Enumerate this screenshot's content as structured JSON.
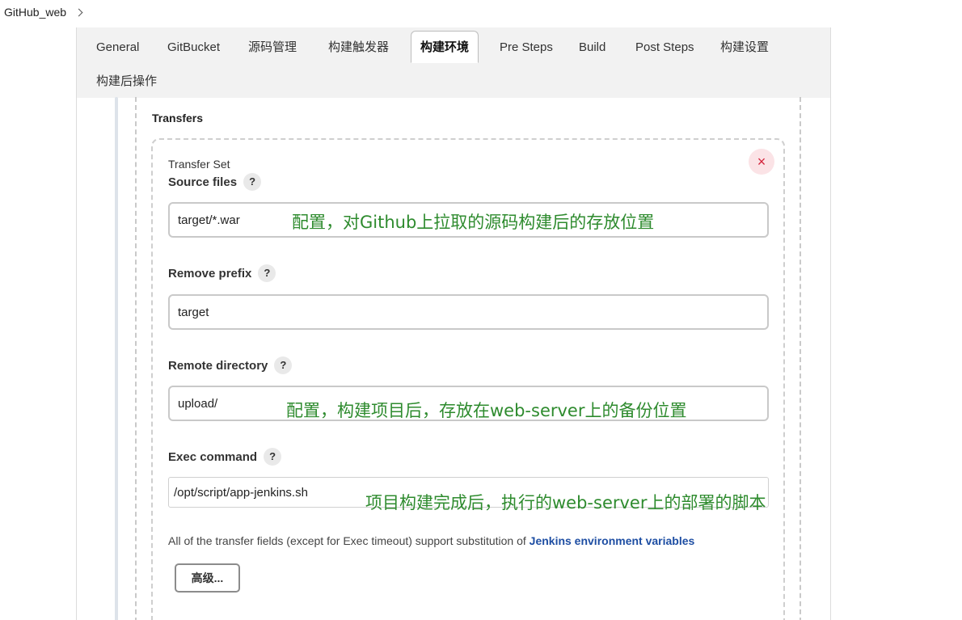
{
  "breadcrumb": {
    "label": "GitHub_web"
  },
  "tabs": [
    {
      "label": "General"
    },
    {
      "label": "GitBucket"
    },
    {
      "label": "源码管理"
    },
    {
      "label": "构建触发器"
    },
    {
      "label": "构建环境",
      "active": true
    },
    {
      "label": "Pre Steps"
    },
    {
      "label": "Build"
    },
    {
      "label": "Post Steps"
    },
    {
      "label": "构建设置"
    },
    {
      "label": "构建后操作"
    }
  ],
  "section": {
    "title": "Transfers"
  },
  "transfer_set": {
    "label": "Transfer Set",
    "close_symbol": "×",
    "help_symbol": "?",
    "source_files": {
      "label": "Source files",
      "value": "target/*.war"
    },
    "remove_prefix": {
      "label": "Remove prefix",
      "value": "target"
    },
    "remote_directory": {
      "label": "Remote directory",
      "value": "upload/"
    },
    "exec_command": {
      "label": "Exec command",
      "value": "/opt/script/app-jenkins.sh"
    }
  },
  "annotations": {
    "source_files": "配置，对Github上拉取的源码构建后的存放位置",
    "remote_directory": "配置，构建项目后，存放在web-server上的备份位置",
    "exec_command": "项目构建完成后，执行的web-server上的部署的脚本"
  },
  "hint": {
    "text": "All of the transfer fields (except for Exec timeout) support substitution of ",
    "link": "Jenkins environment variables"
  },
  "advanced_button": {
    "label": "高级..."
  },
  "colors": {
    "annotation": "#2e8b2e",
    "link": "#1e4ea3",
    "close": "#d3243b"
  }
}
